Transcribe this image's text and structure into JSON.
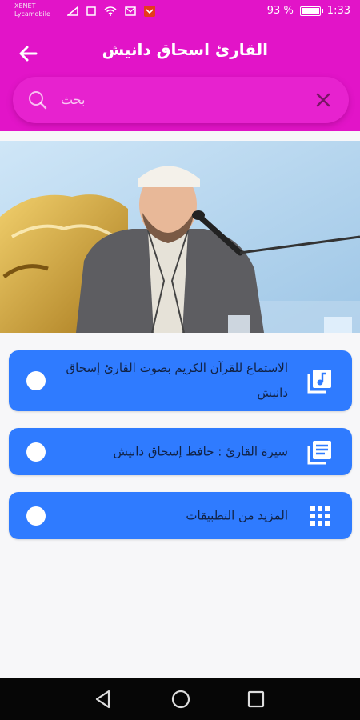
{
  "status_bar": {
    "carrier_line1": "XENET",
    "carrier_line2": "Lycamobile",
    "battery_percent": "93 %",
    "battery_level": 0.93,
    "time": "1:33"
  },
  "header": {
    "title": "القارئ اسحاق دانيش",
    "search_placeholder": "بحث",
    "background_color": "#e214c8"
  },
  "menu": {
    "items": [
      {
        "label": "الاستماع للقرآن الكريم بصوت القارئ إسحاق دانيش",
        "icon": "music-library-icon"
      },
      {
        "label": "سيرة القارئ : حافظ إسحاق دانيش",
        "icon": "library-books-icon"
      },
      {
        "label": "المزيد من التطبيقات",
        "icon": "apps-grid-icon"
      }
    ],
    "button_color": "#2f7bff"
  },
  "nav_bar": {
    "icons": [
      "back-triangle-icon",
      "home-circle-icon",
      "recent-square-icon"
    ]
  }
}
